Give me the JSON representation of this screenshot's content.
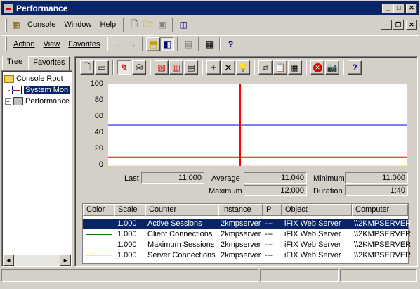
{
  "window": {
    "title": "Performance"
  },
  "menubar": {
    "console": "Console",
    "window": "Window",
    "help": "Help"
  },
  "toolbar": {
    "action": "Action",
    "view": "View",
    "favorites": "Favorites"
  },
  "tabs": {
    "tree": "Tree",
    "favorites": "Favorites"
  },
  "tree": {
    "root": "Console Root",
    "system_monitor": "System Mon",
    "performance_logs": "Performance"
  },
  "graph": {
    "y_ticks": [
      "100",
      "80",
      "60",
      "40",
      "20",
      "0"
    ],
    "ylim": [
      0,
      100
    ],
    "series": [
      {
        "color": "#ff0000",
        "value": 11
      },
      {
        "color": "#008000",
        "value": 0
      },
      {
        "color": "#0000ff",
        "value": 50
      },
      {
        "color": "#ffff00",
        "value": 0
      }
    ],
    "cursor_color": "#ff0000"
  },
  "stats": {
    "last_label": "Last",
    "last": "11.000",
    "average_label": "Average",
    "average": "11.040",
    "minimum_label": "Minimum",
    "minimum": "11.000",
    "maximum_label": "Maximum",
    "maximum": "12.000",
    "duration_label": "Duration",
    "duration": "1:40"
  },
  "legend": {
    "headers": {
      "color": "Color",
      "scale": "Scale",
      "counter": "Counter",
      "instance": "Instance",
      "parent": "P",
      "object": "Object",
      "computer": "Computer"
    },
    "rows": [
      {
        "color": "#ff0000",
        "scale": "1.000",
        "counter": "Active Sessions",
        "instance": "2kmpserver",
        "parent": "---",
        "object": "iFIX Web Server",
        "computer": "\\\\2KMPSERVER"
      },
      {
        "color": "#008000",
        "scale": "1.000",
        "counter": "Client Connections",
        "instance": "2kmpserver",
        "parent": "---",
        "object": "iFIX Web Server",
        "computer": "\\\\2KMPSERVER"
      },
      {
        "color": "#0000ff",
        "scale": "1.000",
        "counter": "Maximum Sessions",
        "instance": "2kmpserver",
        "parent": "---",
        "object": "iFIX Web Server",
        "computer": "\\\\2KMPSERVER"
      },
      {
        "color": "#ffff00",
        "scale": "1.000",
        "counter": "Server Connections",
        "instance": "2kmpserver",
        "parent": "---",
        "object": "iFIX Web Server",
        "computer": "\\\\2KMPSERVER"
      }
    ]
  }
}
